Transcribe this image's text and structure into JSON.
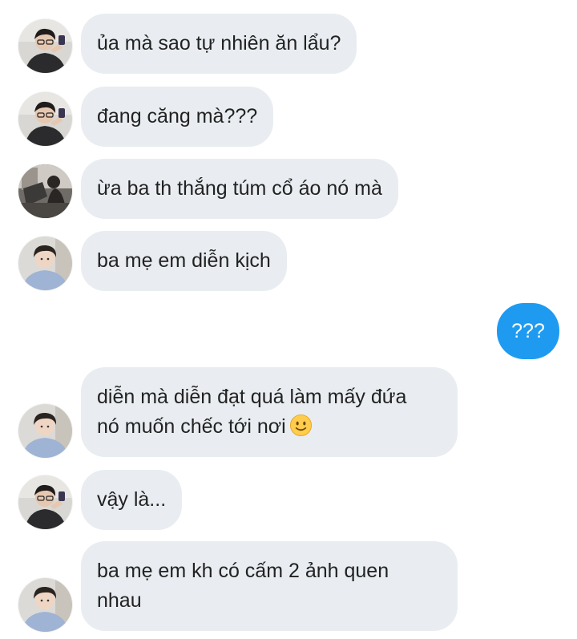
{
  "conversation": {
    "messages": [
      {
        "sender": "guy-glasses",
        "text": "ủa mà sao tự nhiên ăn lẩu?"
      },
      {
        "sender": "guy-glasses",
        "text": "đang căng mà???"
      },
      {
        "sender": "girl-photo",
        "text": "ừa ba th thắng túm cổ áo nó mà"
      },
      {
        "sender": "boy-hoodie",
        "text": "ba mẹ em diễn kịch"
      },
      {
        "sender": "self",
        "text": "???"
      },
      {
        "sender": "boy-hoodie",
        "lines": [
          "diễn mà diễn đạt quá làm mấy đứa",
          "nó muốn chếc tới nơi"
        ],
        "emoji": "slightly-smiling-face-icon"
      },
      {
        "sender": "guy-glasses",
        "text": "vậy là..."
      },
      {
        "sender": "boy-hoodie",
        "lines": [
          "ba mẹ em kh có cấm 2 ảnh quen",
          "nhau"
        ]
      }
    ]
  },
  "colors": {
    "incoming_bubble": "#e9edf1",
    "outgoing_bubble": "#1e9bf0",
    "text": "#222222"
  }
}
